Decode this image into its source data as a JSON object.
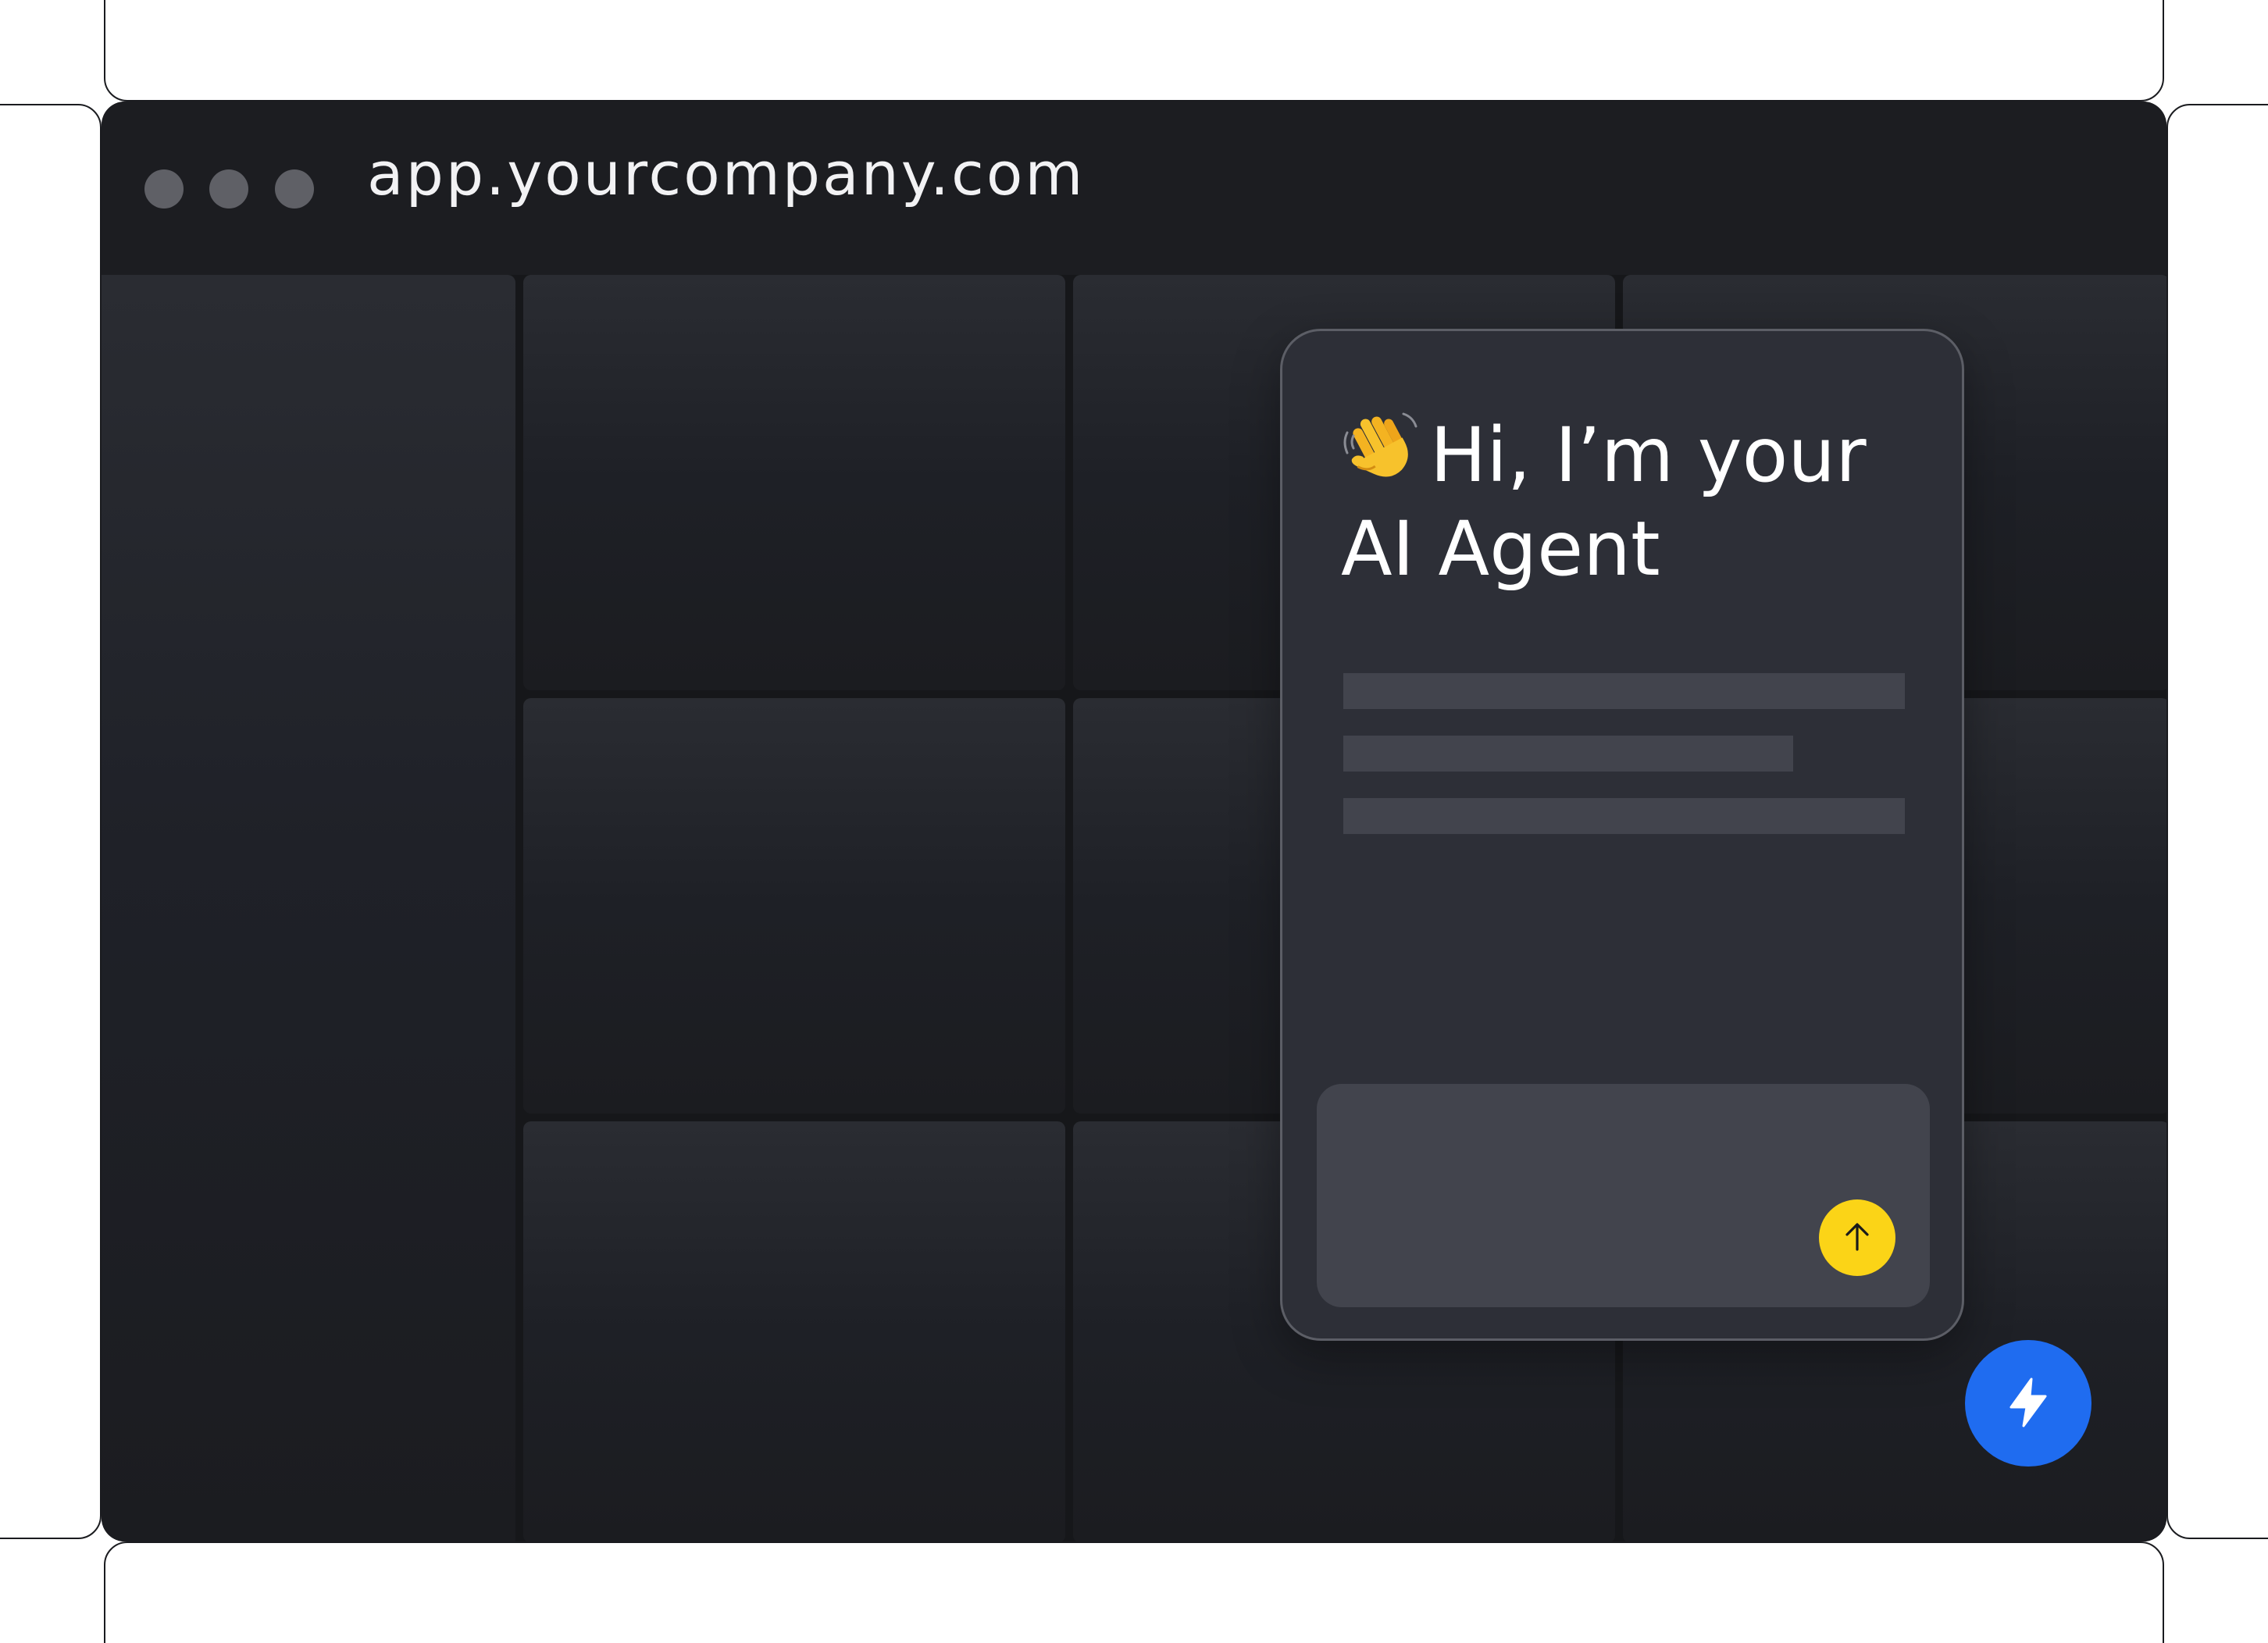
{
  "browser": {
    "url": "app.yourcompany.com"
  },
  "chat_widget": {
    "greeting": "Hi, I’m your AI Agent",
    "greeting_icon": "waving-hand-icon",
    "send_icon": "arrow-up-icon"
  },
  "launcher": {
    "icon": "lightning-bolt-icon"
  },
  "colors": {
    "accent_yellow": "#FBD417",
    "launcher_blue": "#1F6CF0",
    "window_background": "#1C1D21",
    "widget_background": "#2D2F37"
  }
}
